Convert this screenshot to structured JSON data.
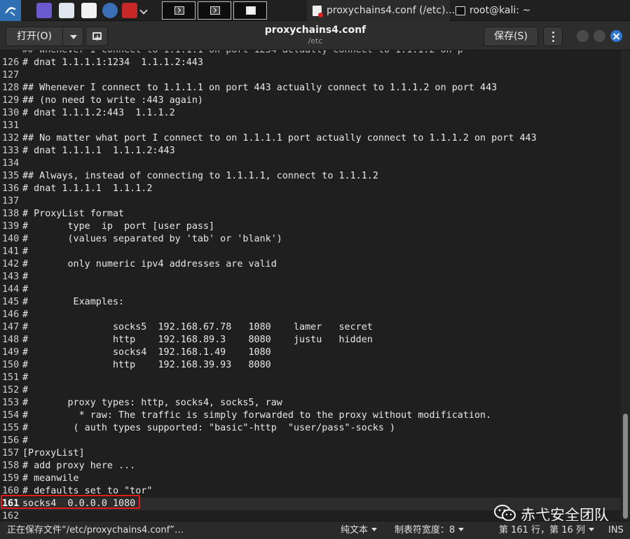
{
  "taskbar": {
    "tasks": [
      {
        "label": "proxychains4.conf (/etc)…",
        "icon": "text-editor-icon"
      },
      {
        "label": "root@kali: ~",
        "icon": "terminal-icon"
      }
    ]
  },
  "header": {
    "open_label": "打开(O)",
    "title": "proxychains4.conf",
    "subtitle": "/etc",
    "save_label": "保存(S)"
  },
  "editor": {
    "lines": [
      {
        "n": "126",
        "t": "# dnat 1.1.1.1:1234  1.1.1.2:443"
      },
      {
        "n": "127",
        "t": ""
      },
      {
        "n": "128",
        "t": "## Whenever I connect to 1.1.1.1 on port 443 actually connect to 1.1.1.2 on port 443"
      },
      {
        "n": "129",
        "t": "## (no need to write :443 again)"
      },
      {
        "n": "130",
        "t": "# dnat 1.1.1.2:443  1.1.1.2"
      },
      {
        "n": "131",
        "t": ""
      },
      {
        "n": "132",
        "t": "## No matter what port I connect to on 1.1.1.1 port actually connect to 1.1.1.2 on port 443"
      },
      {
        "n": "133",
        "t": "# dnat 1.1.1.1  1.1.1.2:443"
      },
      {
        "n": "134",
        "t": ""
      },
      {
        "n": "135",
        "t": "## Always, instead of connecting to 1.1.1.1, connect to 1.1.1.2"
      },
      {
        "n": "136",
        "t": "# dnat 1.1.1.1  1.1.1.2"
      },
      {
        "n": "137",
        "t": ""
      },
      {
        "n": "138",
        "t": "# ProxyList format"
      },
      {
        "n": "139",
        "t": "#       type  ip  port [user pass]"
      },
      {
        "n": "140",
        "t": "#       (values separated by 'tab' or 'blank')"
      },
      {
        "n": "141",
        "t": "#"
      },
      {
        "n": "142",
        "t": "#       only numeric ipv4 addresses are valid"
      },
      {
        "n": "143",
        "t": "#"
      },
      {
        "n": "144",
        "t": "#"
      },
      {
        "n": "145",
        "t": "#        Examples:"
      },
      {
        "n": "146",
        "t": "#"
      },
      {
        "n": "147",
        "t": "#               socks5  192.168.67.78   1080    lamer   secret"
      },
      {
        "n": "148",
        "t": "#               http    192.168.89.3    8080    justu   hidden"
      },
      {
        "n": "149",
        "t": "#               socks4  192.168.1.49    1080"
      },
      {
        "n": "150",
        "t": "#               http    192.168.39.93   8080"
      },
      {
        "n": "151",
        "t": "#"
      },
      {
        "n": "152",
        "t": "#"
      },
      {
        "n": "153",
        "t": "#       proxy types: http, socks4, socks5, raw"
      },
      {
        "n": "154",
        "t": "#         * raw: The traffic is simply forwarded to the proxy without modification."
      },
      {
        "n": "155",
        "t": "#        ( auth types supported: \"basic\"-http  \"user/pass\"-socks )"
      },
      {
        "n": "156",
        "t": "#"
      },
      {
        "n": "157",
        "t": "[ProxyList]"
      },
      {
        "n": "158",
        "t": "# add proxy here ..."
      },
      {
        "n": "159",
        "t": "# meanwile"
      },
      {
        "n": "160",
        "t": "# defaults set to \"tor\""
      },
      {
        "n": "161",
        "t": "socks4  0.0.0.0 1080"
      },
      {
        "n": "162",
        "t": ""
      }
    ],
    "current_line": "161"
  },
  "watermark": {
    "text": "赤弋安全团队"
  },
  "statusbar": {
    "message": "正在保存文件“/etc/proxychains4.conf”…",
    "language": "纯文本",
    "tab_width": "制表符宽度：8",
    "cursor": "第 161 行，第 16 列",
    "mode": "INS"
  },
  "colors": {
    "accent": "#2e77d0",
    "highlight_border": "#e21b1b"
  }
}
